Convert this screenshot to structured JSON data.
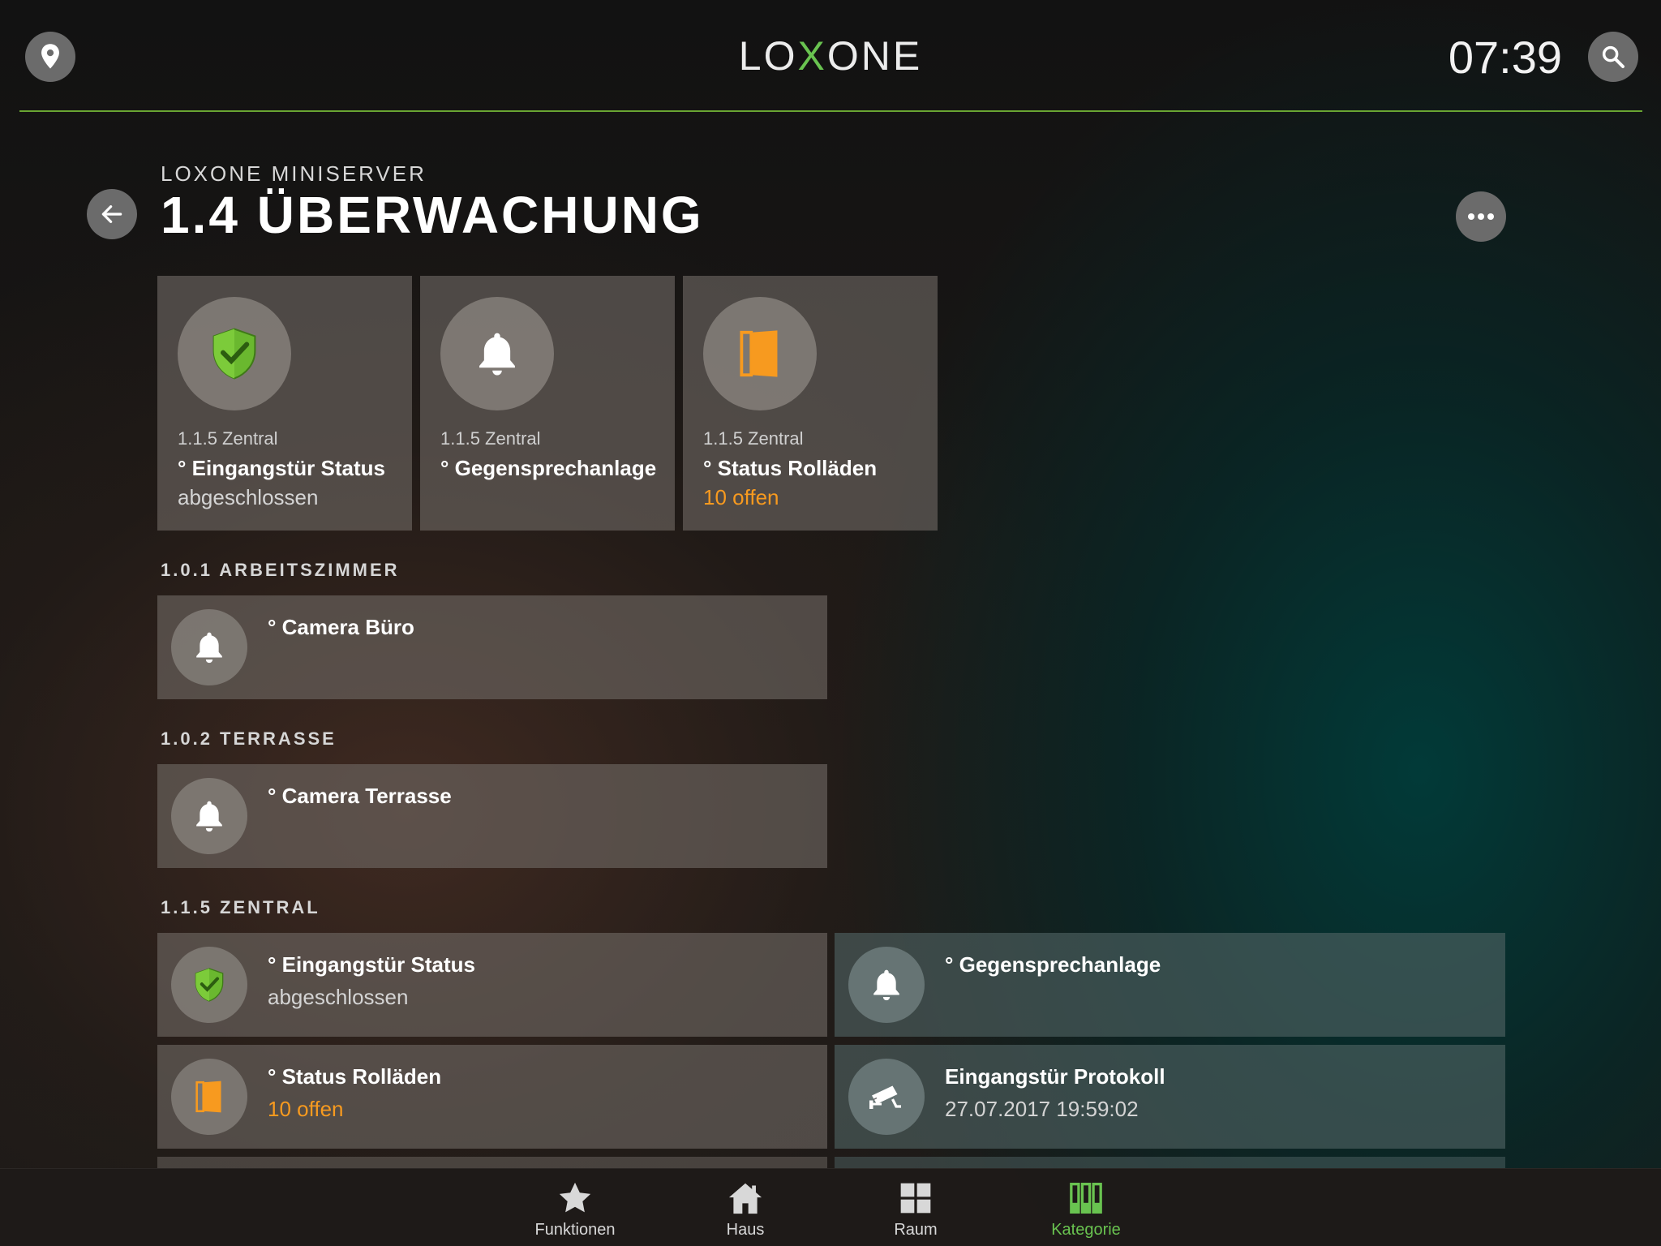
{
  "header": {
    "logo": {
      "pre": "LO",
      "x": "X",
      "post": "ONE"
    },
    "time": "07:39"
  },
  "page": {
    "subtitle": "LOXONE MINISERVER",
    "title": "1.4 ÜBERWACHUNG"
  },
  "tiles": [
    {
      "room": "1.1.5 Zentral",
      "title": "° Eingangstür Status",
      "state": "abgeschlossen",
      "icon": "shield-check-icon"
    },
    {
      "room": "1.1.5 Zentral",
      "title": "° Gegensprechanlage",
      "state": "",
      "icon": "bell-icon"
    },
    {
      "room": "1.1.5 Zentral",
      "title": "° Status Rolläden",
      "state": "10 offen",
      "icon": "door-icon"
    }
  ],
  "sections": [
    {
      "label": "1.0.1 ARBEITSZIMMER",
      "rows": [
        {
          "title": "° Camera Büro",
          "state": ""
        }
      ]
    },
    {
      "label": "1.0.2 TERRASSE",
      "rows": [
        {
          "title": "° Camera Terrasse",
          "state": ""
        }
      ]
    },
    {
      "label": "1.1.5 ZENTRAL",
      "rows": [
        {
          "title": "° Eingangstür Status",
          "state": "abgeschlossen"
        },
        {
          "title": "° Gegensprechanlage",
          "state": ""
        },
        {
          "title": "° Status Rolläden",
          "state": "10 offen"
        },
        {
          "title": "Eingangstür Protokoll",
          "state": "27.07.2017 19:59:02"
        }
      ]
    }
  ],
  "nav": [
    {
      "label": "Funktionen",
      "icon": "star-icon",
      "active": false
    },
    {
      "label": "Haus",
      "icon": "house-icon",
      "active": false
    },
    {
      "label": "Raum",
      "icon": "grid-icon",
      "active": false
    },
    {
      "label": "Kategorie",
      "icon": "category-icon",
      "active": true
    }
  ],
  "colors": {
    "accent": "#69c350",
    "warning": "#f79a1f",
    "line": "#69a532"
  }
}
